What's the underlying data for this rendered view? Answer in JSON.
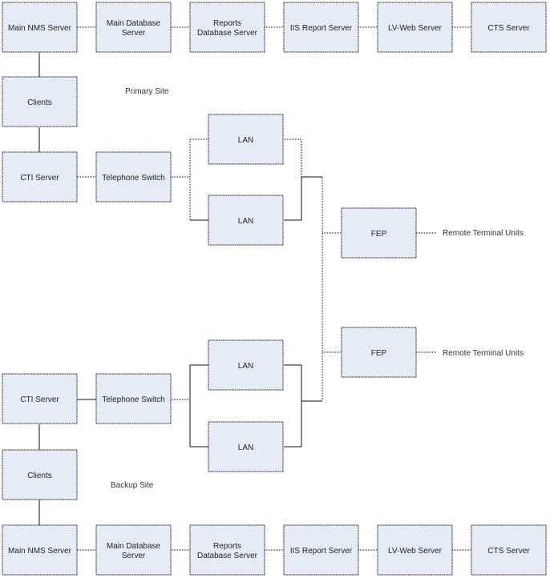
{
  "colors": {
    "box_fill": "#e6ecf6",
    "line": "#111111"
  },
  "primary": {
    "site_label": "Primary Site",
    "servers": [
      "Main NMS Server",
      "Main Database Server",
      "Reports Database Server",
      "IIS Report Server",
      "LV-Web Server",
      "CTS Server"
    ],
    "clients": "Clients",
    "cti": "CTI Server",
    "switch": "Telephone Switch",
    "lan1": "LAN",
    "lan2": "LAN"
  },
  "backup": {
    "site_label": "Backup Site",
    "servers": [
      "Main NMS Server",
      "Main Database Server",
      "Reports Database Server",
      "IIS Report Server",
      "LV-Web Server",
      "CTS Server"
    ],
    "clients": "Clients",
    "cti": "CTI Server",
    "switch": "Telephone Switch",
    "lan1": "LAN",
    "lan2": "LAN"
  },
  "fep": [
    {
      "label": "FEP",
      "rtu": "Remote Terminal Units"
    },
    {
      "label": "FEP",
      "rtu": "Remote Terminal Units"
    }
  ]
}
